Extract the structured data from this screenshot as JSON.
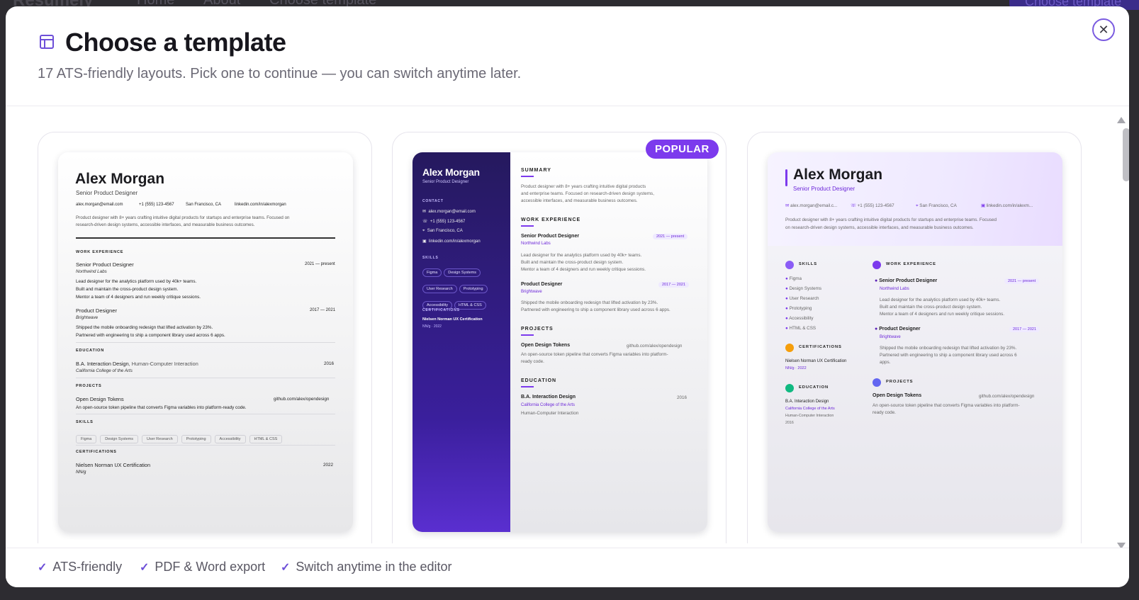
{
  "background": {
    "logo": "Resumely",
    "nav": [
      "Home",
      "About",
      "Choose template"
    ],
    "button": "Choose template"
  },
  "modal": {
    "title": "Choose a template",
    "subtitle": "17 ATS-friendly layouts. Pick one to continue — you can switch anytime later.",
    "close_icon": "close-icon",
    "title_icon": "layout-template-icon",
    "badge": "POPULAR",
    "footer_features": [
      "ATS-friendly",
      "PDF & Word export",
      "Switch anytime in the editor"
    ],
    "accent": "#7c3aed"
  },
  "resume": {
    "name": "Alex Morgan",
    "role": "Senior Product Designer",
    "email": "alex.morgan@email.com",
    "email_short": "alex.morgan@email.c...",
    "phone": "+1 (555) 123-4567",
    "location": "San Francisco, CA",
    "linkedin": "linkedin.com/in/alexmorgan",
    "linkedin_short": "linkedin.com/in/alexm...",
    "summary": "Product designer with 8+ years crafting intuitive digital products for startups and enterprise teams. Focused on research-driven design systems, accessible interfaces, and measurable business outcomes.",
    "summary_a": "Product designer with 8+ years crafting intuitive digital products for startups and enterprise teams. Focused on",
    "summary_b": "research-driven design systems, accessible interfaces, and measurable business outcomes.",
    "summary_2a": "Product designer with 8+ years crafting intuitive digital products",
    "summary_2b": "and enterprise teams. Focused on research-driven design systems,",
    "summary_2c": "accessible interfaces, and measurable business outcomes.",
    "summary_3a": "Product designer with 8+ years crafting intuitive digital products for startups and enterprise teams. Focused",
    "summary_3b": "on research-driven design systems, accessible interfaces, and measurable business outcomes.",
    "sec_summary": "SUMMARY",
    "sec_work": "WORK EXPERIENCE",
    "sec_edu": "EDUCATION",
    "sec_proj": "PROJECTS",
    "sec_skills": "SKILLS",
    "sec_cert": "CERTIFICATIONS",
    "sec_contact": "CONTACT",
    "job1_title": "Senior Product Designer",
    "job1_company": "Northwind Labs",
    "job1_dates": "2021 — present",
    "job1_b1": "Lead designer for the analytics platform used by 40k+ teams.",
    "job1_b2": "Built and maintain the cross-product design system.",
    "job1_b3": "Mentor a team of 4 designers and run weekly critique sessions.",
    "job2_title": "Product Designer",
    "job2_company": "Brightwave",
    "job2_dates": "2017 — 2021",
    "job2_b1": "Shipped the mobile onboarding redesign that lifted activation by 23%.",
    "job2_b2": "Partnered with engineering to ship a component library used across 6 apps.",
    "job2_b2a": "Partnered with engineering to ship a component library used across 6",
    "job2_b2b": "apps.",
    "edu_degree": "B.A. Interaction Design",
    "edu_major": ", Human-Computer Interaction",
    "edu_major_plain": "Human-Computer Interaction",
    "edu_school": "California College of the Arts",
    "edu_year": "2016",
    "proj_name": "Open Design Tokens",
    "proj_url": "github.com/alex/opendesign",
    "proj_desc": "An open-source token pipeline that converts Figma variables into platform-ready code.",
    "proj_desc_a": "An open-source token pipeline that converts Figma variables into platform-",
    "proj_desc_b": "ready code.",
    "skills": [
      "Figma",
      "Design Systems",
      "User Research",
      "Prototyping",
      "Accessibility",
      "HTML & CSS"
    ],
    "cert_name": "Nielsen Norman UX Certification",
    "cert_org": "NN/g",
    "cert_year": "2022",
    "cert_org_year": "NN/g · 2022"
  }
}
